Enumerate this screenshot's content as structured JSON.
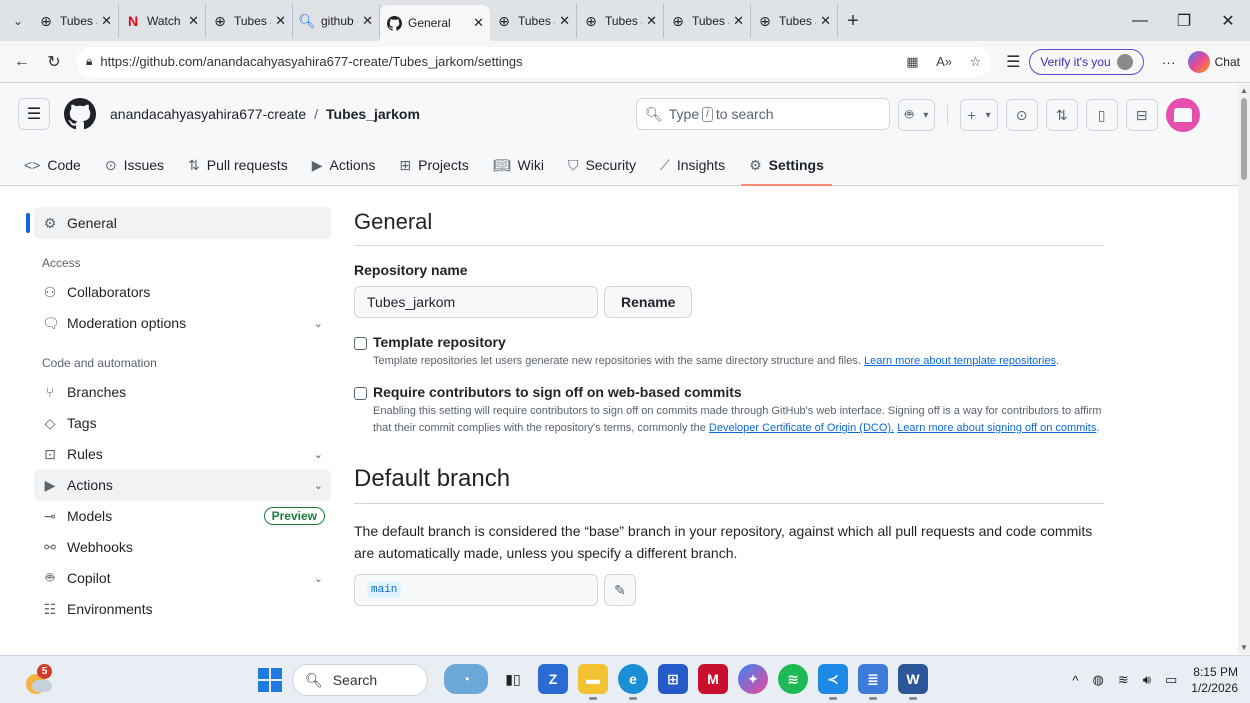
{
  "browser": {
    "tabs": [
      {
        "label": "Tubes Jarin",
        "icon": "globe-icon"
      },
      {
        "label": "Watch Kelu",
        "icon": "netflix-icon"
      },
      {
        "label": "Tubes Jarin",
        "icon": "globe-icon"
      },
      {
        "label": "github - Se",
        "icon": "search-icon"
      },
      {
        "label": "General",
        "icon": "github-icon",
        "active": true
      },
      {
        "label": "Tubes Jarin",
        "icon": "globe-icon"
      },
      {
        "label": "Tubes Jarin",
        "icon": "globe-icon"
      },
      {
        "label": "Tubes Jarin",
        "icon": "globe-icon"
      },
      {
        "label": "Tubes Jarin",
        "icon": "globe-icon"
      }
    ],
    "url": "https://github.com/anandacahyasyahira677-create/Tubes_jarkom/settings",
    "verify_label": "Verify it's you",
    "chat_label": "Chat"
  },
  "header": {
    "owner": "anandacahyasyahira677-create",
    "separator": "/",
    "repo": "Tubes_jarkom",
    "search_pre": "Type",
    "search_key": "/",
    "search_post": "to search"
  },
  "repo_nav": {
    "tabs": [
      {
        "label": "Code",
        "icon": "code-icon"
      },
      {
        "label": "Issues",
        "icon": "issue-icon"
      },
      {
        "label": "Pull requests",
        "icon": "pull-request-icon"
      },
      {
        "label": "Actions",
        "icon": "play-icon"
      },
      {
        "label": "Projects",
        "icon": "table-icon"
      },
      {
        "label": "Wiki",
        "icon": "book-icon"
      },
      {
        "label": "Security",
        "icon": "shield-icon"
      },
      {
        "label": "Insights",
        "icon": "graph-icon"
      },
      {
        "label": "Settings",
        "icon": "gear-icon",
        "active": true
      }
    ]
  },
  "sidebar": {
    "general": "General",
    "group_access": "Access",
    "collaborators": "Collaborators",
    "moderation": "Moderation options",
    "group_code": "Code and automation",
    "branches": "Branches",
    "tags": "Tags",
    "rules": "Rules",
    "actions": "Actions",
    "models": "Models",
    "models_badge": "Preview",
    "webhooks": "Webhooks",
    "copilot": "Copilot",
    "environments": "Environments"
  },
  "main": {
    "title": "General",
    "repo_name_label": "Repository name",
    "repo_name_value": "Tubes_jarkom",
    "rename_label": "Rename",
    "template_title": "Template repository",
    "template_desc": "Template repositories let users generate new repositories with the same directory structure and files.",
    "template_link": "Learn more about template repositories",
    "signoff_title": "Require contributors to sign off on web-based commits",
    "signoff_desc": "Enabling this setting will require contributors to sign off on commits made through GitHub's web interface. Signing off is a way for contributors to affirm that their commit complies with the repository's terms, commonly the",
    "signoff_link1": "Developer Certificate of Origin (DCO).",
    "signoff_link2": "Learn more about signing off on commits",
    "default_branch_title": "Default branch",
    "default_branch_desc": "The default branch is considered the “base” branch in your repository, against which all pull requests and code commits are automatically made, unless you specify a different branch.",
    "default_branch_value": "main"
  },
  "taskbar": {
    "weather_badge": "5",
    "search_label": "Search",
    "time": "8:15 PM",
    "date": "1/2/2026"
  },
  "colors": {
    "accent": "#0969da",
    "active_tab_underline": "#fd8c73",
    "preview_green": "#1a7f37",
    "avatar": "#e64fae"
  }
}
